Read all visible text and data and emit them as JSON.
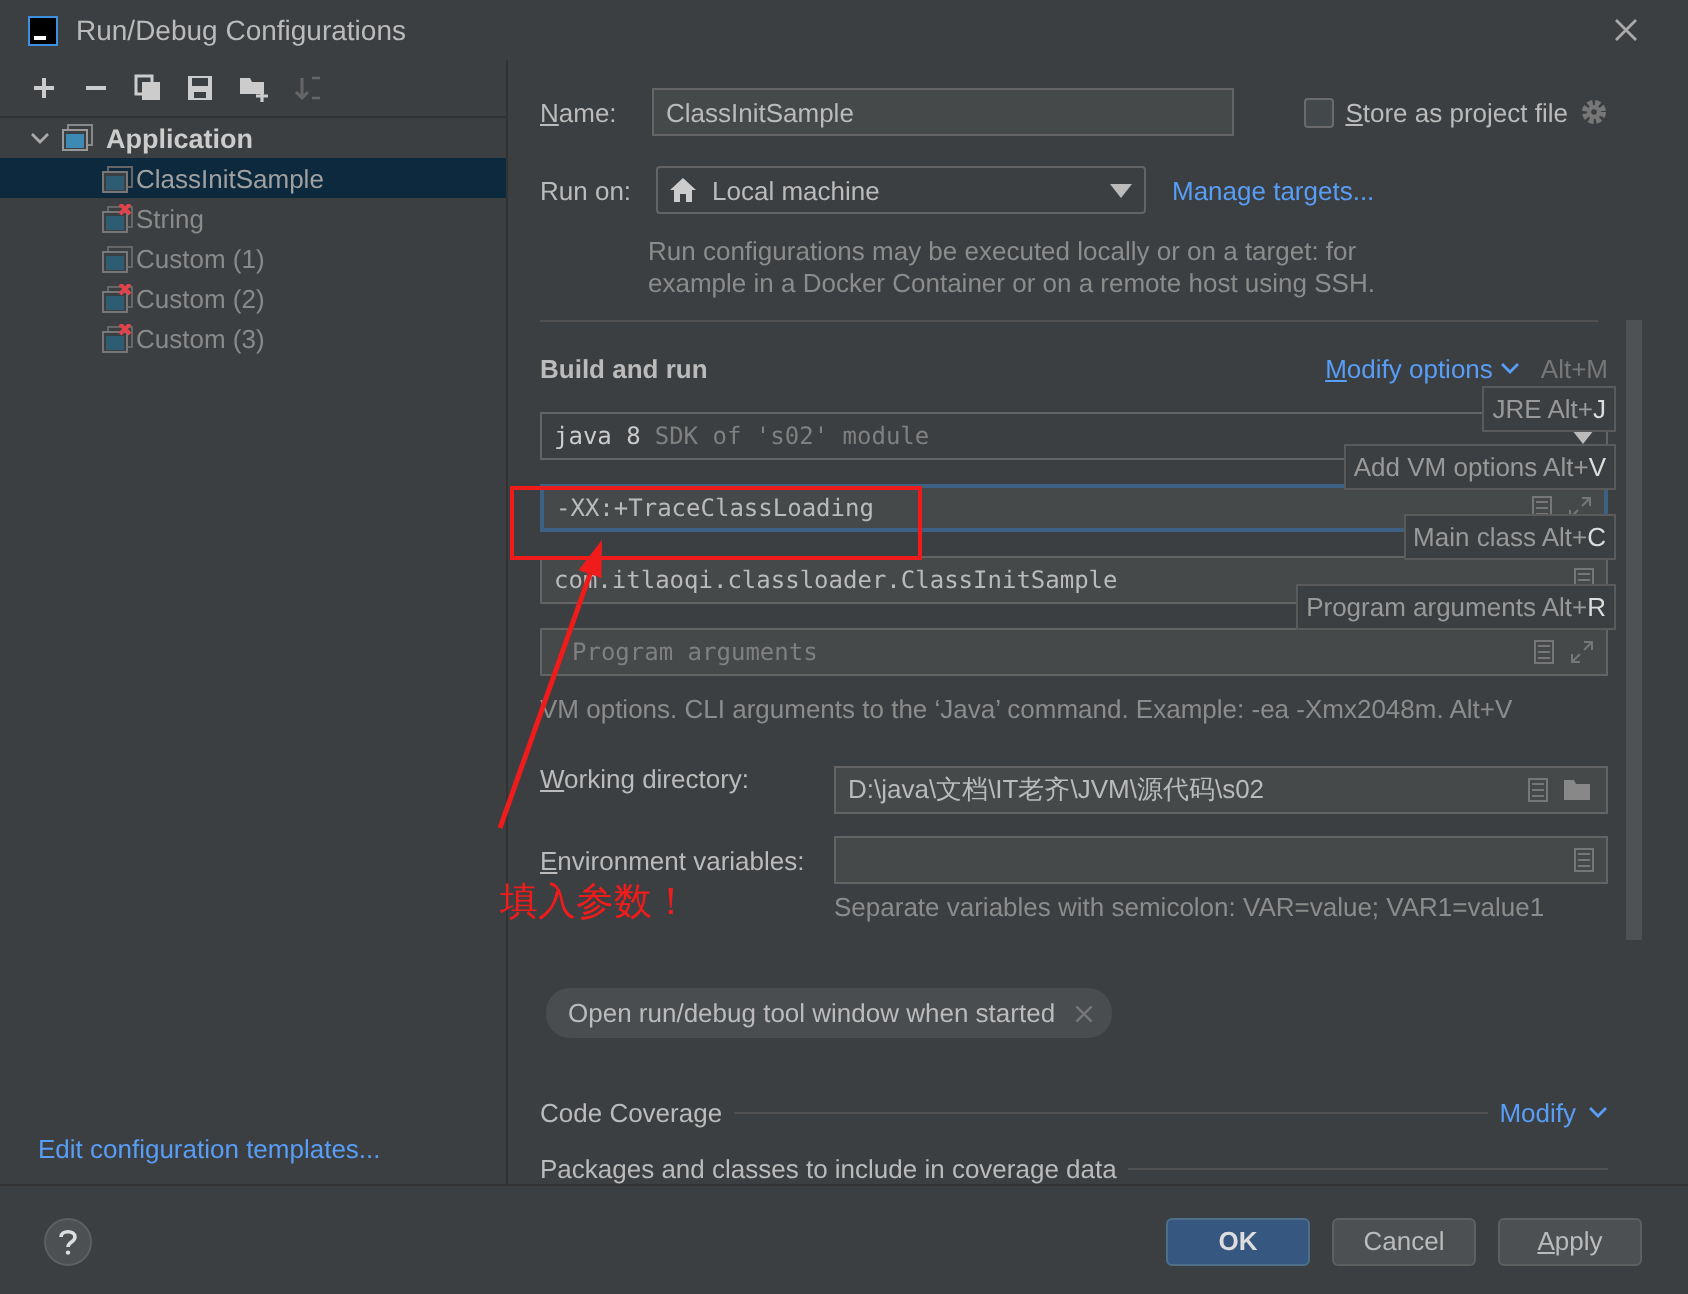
{
  "window": {
    "title": "Run/Debug Configurations"
  },
  "tree": {
    "label": "Application",
    "expanded": true,
    "children": [
      {
        "label": "ClassInitSample",
        "selected": true,
        "error": false
      },
      {
        "label": "String",
        "selected": false,
        "error": true
      },
      {
        "label": "Custom (1)",
        "selected": false,
        "error": false
      },
      {
        "label": "Custom (2)",
        "selected": false,
        "error": true
      },
      {
        "label": "Custom (3)",
        "selected": false,
        "error": true
      }
    ]
  },
  "templates_link": "Edit configuration templates...",
  "name": {
    "label": "Name:",
    "value": "ClassInitSample"
  },
  "store_as_project_file": {
    "label": "Store as project file",
    "checked": false
  },
  "run_on": {
    "label": "Run on:",
    "value": "Local machine",
    "link": "Manage targets..."
  },
  "run_on_hint": "Run configurations may be executed locally or on a target: for example in a Docker Container or on a remote host using SSH.",
  "build_and_run": {
    "title": "Build and run",
    "modify": "Modify options",
    "modify_shortcut": "Alt+M",
    "jre": {
      "value": "java 8",
      "hint": "SDK of 's02' module"
    },
    "vm_options": {
      "value": "-XX:+TraceClassLoading",
      "focused": true
    },
    "main_class": {
      "value": "com.itlaoqi.classloader.ClassInitSample"
    },
    "program_arguments": {
      "placeholder": "Program arguments"
    },
    "vm_hint": "VM options. CLI arguments to the ‘Java’ command. Example: -ea -Xmx2048m. Alt+V"
  },
  "shortcut_hints": [
    {
      "label": "JRE Alt+",
      "key": "J"
    },
    {
      "label": "Add VM options Alt+",
      "key": "V"
    },
    {
      "label": "Main class Alt+",
      "key": "C"
    },
    {
      "label": "Program arguments Alt+",
      "key": "R"
    }
  ],
  "working_directory": {
    "label": "Working directory:",
    "value": "D:\\java\\文档\\IT老齐\\JVM\\源代码\\s02"
  },
  "environment_variables": {
    "label": "Environment variables:",
    "hint": "Separate variables with semicolon: VAR=value; VAR1=value1"
  },
  "chip": {
    "label": "Open run/debug tool window when started"
  },
  "code_coverage": {
    "title": "Code Coverage",
    "modify": "Modify",
    "packages": "Packages and classes to include in coverage data"
  },
  "annotation": {
    "text": "填入参数！"
  },
  "buttons": [
    {
      "label": "OK",
      "kind": "primary"
    },
    {
      "label": "Cancel",
      "kind": "normal"
    },
    {
      "label": "Apply",
      "kind": "normal"
    }
  ]
}
